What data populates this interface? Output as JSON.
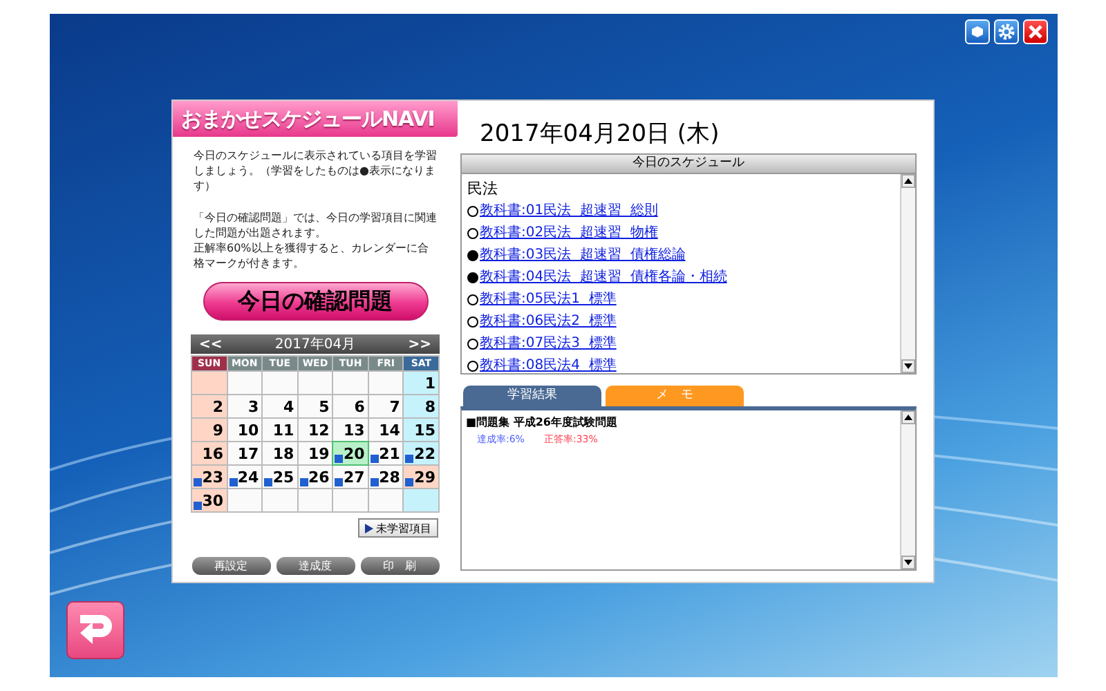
{
  "app_title": "おまかせスケジュールNAVI",
  "intro": [
    "今日のスケジュールに表示されている項目を学習しましょう。（学習をしたものは●表示になります）",
    "「今日の確認問題」では、今日の学習項目に関連した問題が出題されます。",
    "正解率60%以上を獲得すると、カレンダーに合格マークが付きます。"
  ],
  "quiz_button": "今日の確認問題",
  "calendar": {
    "prev": "<<",
    "month": "2017年04月",
    "next": ">>",
    "weekdays": [
      {
        "label": "SUN",
        "kind": "sun"
      },
      {
        "label": "MON",
        "kind": "weekday"
      },
      {
        "label": "TUE",
        "kind": "weekday"
      },
      {
        "label": "WED",
        "kind": "weekday"
      },
      {
        "label": "TUH",
        "kind": "weekday"
      },
      {
        "label": "FRI",
        "kind": "weekday"
      },
      {
        "label": "SAT",
        "kind": "sat"
      }
    ],
    "weeks": [
      [
        {
          "kind": "sun"
        },
        {
          "kind": "weekday"
        },
        {
          "kind": "weekday"
        },
        {
          "kind": "weekday"
        },
        {
          "kind": "weekday"
        },
        {
          "kind": "weekday"
        },
        {
          "day": "1",
          "kind": "sat",
          "marked": false
        }
      ],
      [
        {
          "day": "2",
          "kind": "sun",
          "marked": false
        },
        {
          "day": "3",
          "kind": "weekday",
          "marked": false
        },
        {
          "day": "4",
          "kind": "weekday",
          "marked": false
        },
        {
          "day": "5",
          "kind": "weekday",
          "marked": false
        },
        {
          "day": "6",
          "kind": "weekday",
          "marked": false
        },
        {
          "day": "7",
          "kind": "weekday",
          "marked": false
        },
        {
          "day": "8",
          "kind": "sat",
          "marked": false
        }
      ],
      [
        {
          "day": "9",
          "kind": "sun",
          "marked": false
        },
        {
          "day": "10",
          "kind": "weekday",
          "marked": false
        },
        {
          "day": "11",
          "kind": "weekday",
          "marked": false
        },
        {
          "day": "12",
          "kind": "weekday",
          "marked": false
        },
        {
          "day": "13",
          "kind": "weekday",
          "marked": false
        },
        {
          "day": "14",
          "kind": "weekday",
          "marked": false
        },
        {
          "day": "15",
          "kind": "sat",
          "marked": false
        }
      ],
      [
        {
          "day": "16",
          "kind": "sun",
          "marked": false
        },
        {
          "day": "17",
          "kind": "weekday",
          "marked": false
        },
        {
          "day": "18",
          "kind": "weekday",
          "marked": false
        },
        {
          "day": "19",
          "kind": "weekday",
          "marked": false
        },
        {
          "day": "20",
          "kind": "today",
          "marked": true
        },
        {
          "day": "21",
          "kind": "weekday",
          "marked": true
        },
        {
          "day": "22",
          "kind": "sat",
          "marked": true
        }
      ],
      [
        {
          "day": "23",
          "kind": "sun",
          "marked": true
        },
        {
          "day": "24",
          "kind": "weekday",
          "marked": true
        },
        {
          "day": "25",
          "kind": "weekday",
          "marked": true
        },
        {
          "day": "26",
          "kind": "weekday",
          "marked": true
        },
        {
          "day": "27",
          "kind": "weekday",
          "marked": true
        },
        {
          "day": "28",
          "kind": "weekday",
          "marked": true
        },
        {
          "day": "29",
          "kind": "sun",
          "marked": true
        }
      ],
      [
        {
          "day": "30",
          "kind": "sun",
          "marked": true
        },
        {
          "kind": "weekday"
        },
        {
          "kind": "weekday"
        },
        {
          "kind": "weekday"
        },
        {
          "kind": "weekday"
        },
        {
          "kind": "weekday"
        },
        {
          "kind": "sat"
        }
      ]
    ]
  },
  "unstudied_button": "未学習項目",
  "bottom_buttons": [
    "再設定",
    "達成度",
    "印　刷"
  ],
  "date": "2017年04月20日 (木)",
  "schedule": {
    "title": "今日のスケジュール",
    "subject": "民法",
    "items": [
      {
        "label": "教科書:01民法  超速習  総則",
        "done": false
      },
      {
        "label": "教科書:02民法  超速習  物権",
        "done": false
      },
      {
        "label": "教科書:03民法  超速習  債権総論",
        "done": true
      },
      {
        "label": "教科書:04民法  超速習  債権各論・相続",
        "done": true
      },
      {
        "label": "教科書:05民法1  標準",
        "done": false
      },
      {
        "label": "教科書:06民法2  標準",
        "done": false
      },
      {
        "label": "教科書:07民法3  標準",
        "done": false
      },
      {
        "label": "教科書:08民法4  標準",
        "done": false
      }
    ]
  },
  "tabs": [
    {
      "label": "学習結果",
      "selected": true
    },
    {
      "label": "メ　モ",
      "selected": false
    }
  ],
  "results": [
    {
      "title": "■問題集 平成26年度試験問題",
      "achievement": "達成率:6%",
      "correct": "正答率:33%"
    }
  ]
}
